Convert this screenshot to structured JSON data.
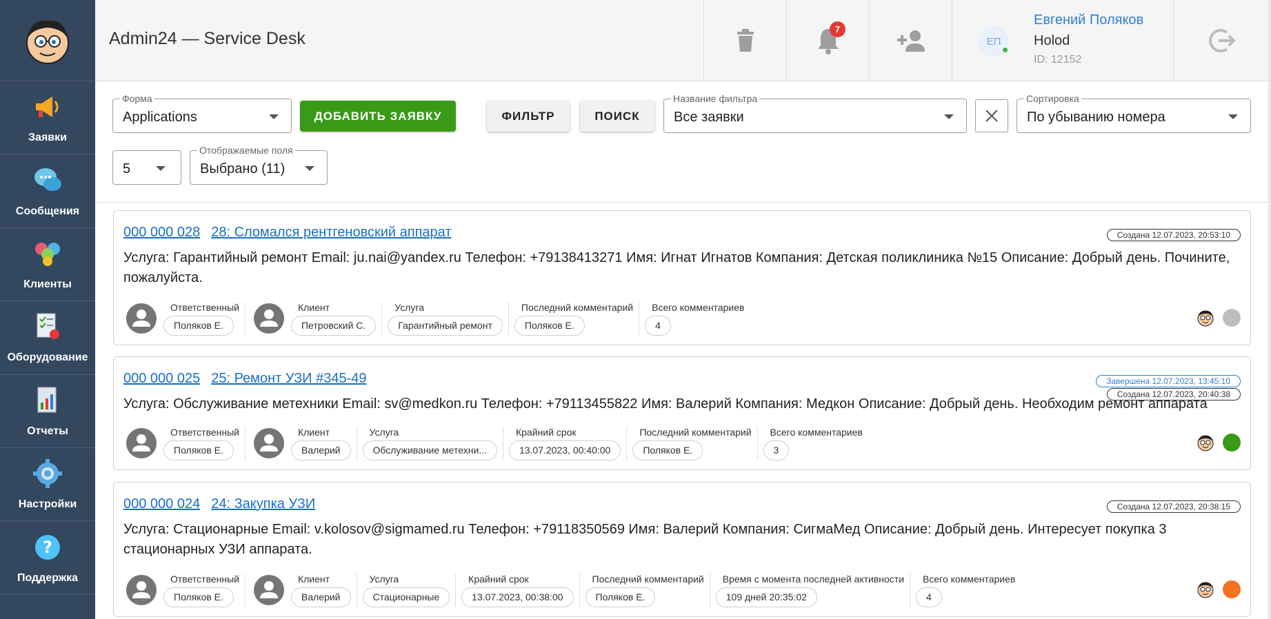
{
  "sidebar": {
    "items": [
      {
        "label": "Заявки",
        "icon": "megaphone-icon"
      },
      {
        "label": "Сообщения",
        "icon": "chat-bubbles-icon"
      },
      {
        "label": "Клиенты",
        "icon": "clients-icon"
      },
      {
        "label": "Оборудование",
        "icon": "equipment-checklist-icon"
      },
      {
        "label": "Отчеты",
        "icon": "report-icon"
      },
      {
        "label": "Настройки",
        "icon": "gear-icon"
      },
      {
        "label": "Поддержка",
        "icon": "help-icon"
      }
    ]
  },
  "header": {
    "title": "Admin24 — Service Desk",
    "notifications_count": "7",
    "user": {
      "initials": "ЕП",
      "name": "Евгений Поляков",
      "org": "Holod",
      "id": "ID: 12152"
    }
  },
  "toolbar": {
    "form": {
      "label": "Форма",
      "value": "Applications"
    },
    "add_label": "ДОБАВИТЬ ЗАЯВКУ",
    "filter_label": "ФИЛЬТР",
    "search_label": "ПОИСК",
    "filter_name": {
      "label": "Название фильтра",
      "value": "Все заявки"
    },
    "sort": {
      "label": "Сортировка",
      "value": "По убыванию номера"
    },
    "page_size": {
      "value": "5"
    },
    "fields": {
      "label": "Отображаемые поля",
      "value": "Выбрано (11)"
    }
  },
  "cards": [
    {
      "number": "000 000 028",
      "title": "28: Сломался рентгеновский аппарат",
      "pills": [
        {
          "text": "Создана 12.07.2023, 20:53:10",
          "color": "#333333"
        }
      ],
      "desc_lines": [
        "Услуга: Гарантийный ремонт Email: ju.nai@yandex.ru Телефон: +79138413271 Имя: Игнат Игнатов Компания: Детская поликлиника №15 Описание: Добрый день. Почините,",
        "пожалуйста."
      ],
      "meta": [
        {
          "label": "Ответственный",
          "value": "Поляков Е.",
          "person": true
        },
        {
          "label": "Клиент",
          "value": "Петровский С.",
          "person": true
        },
        {
          "label": "Услуга",
          "value": "Гарантийный ремонт"
        },
        {
          "label": "Последний комментарий",
          "value": "Поляков Е."
        },
        {
          "label": "Всего комментариев",
          "value": "4"
        }
      ],
      "status_color": "#bdbdbd"
    },
    {
      "number": "000 000 025",
      "title": "25: Ремонт УЗИ #345-49",
      "pills": [
        {
          "text": "Завершена 12.07.2023, 13:45:10",
          "color": "#2e7fd4"
        },
        {
          "text": "Создана 12.07.2023, 20:40:38",
          "color": "#333333"
        }
      ],
      "desc_lines": [
        "Услуга: Обслуживание метехники Email: sv@medkon.ru Телефон: +79113455822 Имя: Валерий Компания: Медкон Описание: Добрый день. Необходим ремонт аппарата"
      ],
      "meta": [
        {
          "label": "Ответственный",
          "value": "Поляков Е.",
          "person": true
        },
        {
          "label": "Клиент",
          "value": "Валерий",
          "person": true
        },
        {
          "label": "Услуга",
          "value": "Обслуживание метехни..."
        },
        {
          "label": "Крайний срок",
          "value": "13.07.2023, 00:40:00"
        },
        {
          "label": "Последний комментарий",
          "value": "Поляков Е."
        },
        {
          "label": "Всего комментариев",
          "value": "3"
        }
      ],
      "status_color": "#3a9a18"
    },
    {
      "number": "000 000 024",
      "title": "24: Закупка УЗИ",
      "pills": [
        {
          "text": "Создана 12.07.2023, 20:38:15",
          "color": "#333333"
        }
      ],
      "desc_lines": [
        "Услуга: Стационарные Email: v.kolosov@sigmamed.ru Телефон: +79118350569 Имя: Валерий Компания: СигмаМед Описание: Добрый день. Интересует покупка 3",
        "стационарных УЗИ аппарата."
      ],
      "meta": [
        {
          "label": "Ответственный",
          "value": "Поляков Е.",
          "person": true
        },
        {
          "label": "Клиент",
          "value": "Валерий",
          "person": true
        },
        {
          "label": "Услуга",
          "value": "Стационарные"
        },
        {
          "label": "Крайний срок",
          "value": "13.07.2023, 00:38:00"
        },
        {
          "label": "Последний комментарий",
          "value": "Поляков Е."
        },
        {
          "label": "Время с момента последней активности",
          "value": "109 дней 20:35:02"
        },
        {
          "label": "Всего комментариев",
          "value": "4"
        }
      ],
      "status_color": "#f47321"
    }
  ]
}
